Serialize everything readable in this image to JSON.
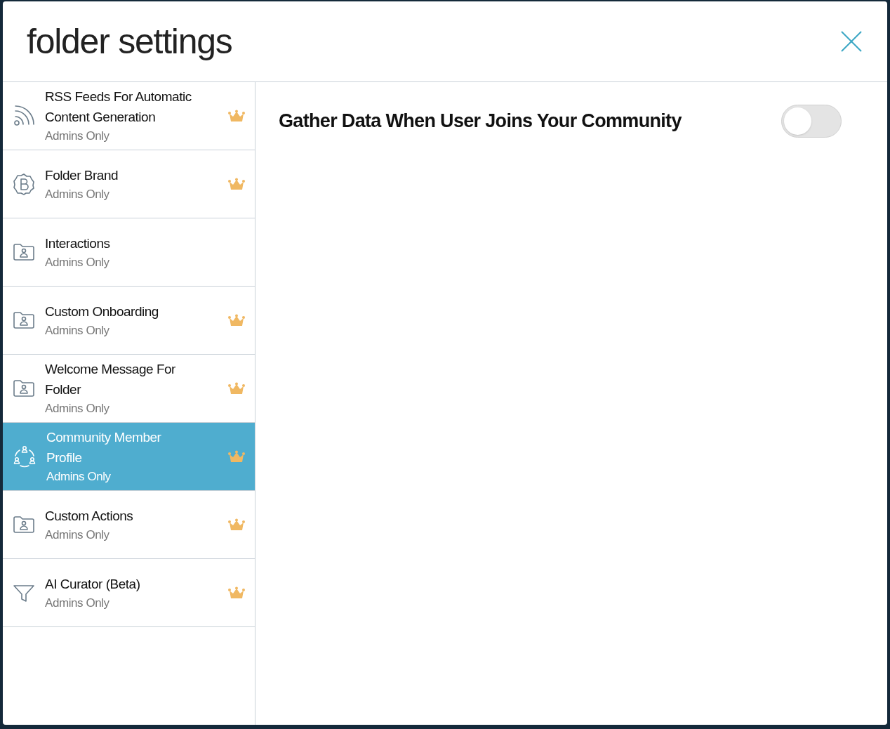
{
  "dialog": {
    "title": "folder settings"
  },
  "sidebar": {
    "items": [
      {
        "kind": "rss",
        "title": "RSS Feeds For Automatic Content Generation",
        "subtitle": "Admins Only",
        "premium": true,
        "selected": false
      },
      {
        "kind": "brand",
        "title": "Folder Brand",
        "subtitle": "Admins Only",
        "premium": true,
        "selected": false
      },
      {
        "kind": "folder",
        "title": "Interactions",
        "subtitle": "Admins Only",
        "premium": false,
        "selected": false
      },
      {
        "kind": "folder",
        "title": "Custom Onboarding",
        "subtitle": "Admins Only",
        "premium": true,
        "selected": false
      },
      {
        "kind": "folder",
        "title": "Welcome Message For Folder",
        "subtitle": "Admins Only",
        "premium": true,
        "selected": false
      },
      {
        "kind": "community",
        "title": "Community Member Profile",
        "subtitle": "Admins Only",
        "premium": true,
        "selected": true
      },
      {
        "kind": "folder",
        "title": "Custom Actions",
        "subtitle": "Admins Only",
        "premium": true,
        "selected": false
      },
      {
        "kind": "filter",
        "title": "AI Curator (Beta)",
        "subtitle": "Admins Only",
        "premium": true,
        "selected": false
      }
    ]
  },
  "content": {
    "setting": {
      "label": "Gather Data When User Joins Your Community",
      "on": false
    }
  }
}
